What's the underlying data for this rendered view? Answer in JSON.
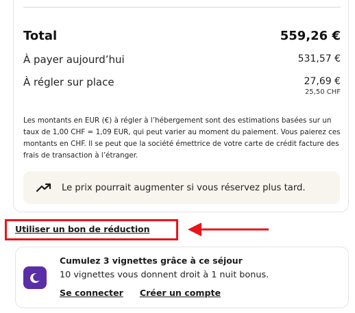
{
  "summary": {
    "total_label": "Total",
    "total_value": "559,26 €",
    "pay_today_label": "À payer aujourd’hui",
    "pay_today_value": "531,57 €",
    "pay_on_site_label": "À régler sur place",
    "pay_on_site_value": "27,69 €",
    "pay_on_site_chf": "25,50 CHF",
    "note": "Les montants en EUR (€) à régler à l’hébergement sont des estimations basées sur un taux de 1,00 CHF = 1,09 EUR, qui peut varier au moment du paiement. Vous paierez ces montants en CHF. Il se peut que la société émettrice de votre carte de crédit facture des frais de transaction à l’étranger.",
    "price_banner": "Le prix pourrait augmenter si vous réservez plus tard.",
    "price_banner_icon": "trending-up-icon"
  },
  "voucher": {
    "link_label": "Utiliser un bon de réduction",
    "highlight_color": "#e8141b"
  },
  "stamps": {
    "title": "Cumulez 3 vignettes grâce à ce séjour",
    "description": "10 vignettes vous donnent droit à 1 nuit bonus.",
    "sign_in_label": "Se connecter",
    "create_account_label": "Créer un compte",
    "badge_icon": "moon-icon",
    "badge_color": "#5a2ea6"
  }
}
